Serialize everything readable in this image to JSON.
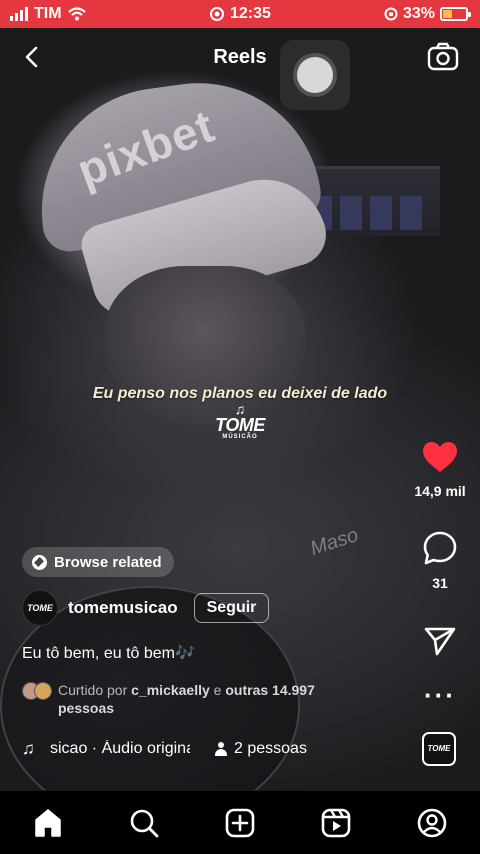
{
  "status_bar": {
    "carrier": "TIM",
    "time": "12:35",
    "battery": "33%",
    "bar_color": "#e5373f"
  },
  "header": {
    "title": "Reels",
    "back_icon": "chevron-left-icon",
    "camera_icon": "camera-icon"
  },
  "video": {
    "lyric": "Eu penso nos planos eu deixei de lado",
    "watermark": {
      "name": "TOME",
      "sub": "MÚSICÃO"
    }
  },
  "actions": {
    "likes": "14,9 mil",
    "comments": "31",
    "like_color": "#ff3040"
  },
  "browse_related": "Browse related",
  "author": {
    "username": "tomemusicao",
    "follow_label": "Seguir",
    "avatar_text": "TOME"
  },
  "caption": "Eu tô bem, eu tô bem🎶",
  "liked_by": {
    "prefix": "Curtido por ",
    "user": "c_mickaelly",
    "middle": " e ",
    "others": "outras 14.997",
    "suffix": " pessoas"
  },
  "audio": {
    "track": "sicao · Áudio original",
    "people": "2 pessoas",
    "thumb_text": "TOME"
  },
  "nav": [
    "home-icon",
    "search-icon",
    "create-icon",
    "reels-icon",
    "profile-icon"
  ]
}
